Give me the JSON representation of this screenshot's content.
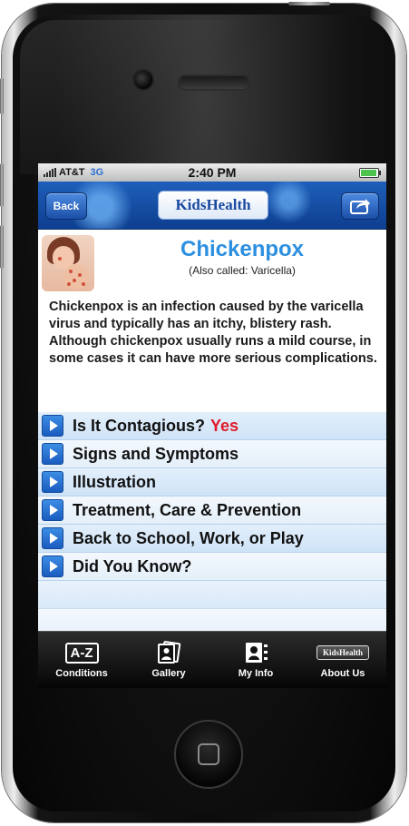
{
  "status": {
    "carrier": "AT&T",
    "network": "3G",
    "time": "2:40 PM",
    "battery_fraction": 0.95
  },
  "nav": {
    "back_label": "Back",
    "logo_text": "KidsHealth"
  },
  "article": {
    "title": "Chickenpox",
    "subtitle": "(Also called: Varicella)",
    "description": "Chickenpox is an infection caused by the varicella virus and typically has an itchy, blistery rash. Although chickenpox usually runs a mild course, in some cases it can have more serious complications."
  },
  "sections": [
    {
      "label": "Is It Contagious?",
      "answer": "Yes"
    },
    {
      "label": "Signs and Symptoms"
    },
    {
      "label": "Illustration"
    },
    {
      "label": "Treatment, Care & Prevention"
    },
    {
      "label": "Back to School, Work, or Play"
    },
    {
      "label": "Did You Know?"
    }
  ],
  "tabs": [
    {
      "label": "Conditions",
      "icon": "a-z-icon",
      "icon_text": "A-Z"
    },
    {
      "label": "Gallery",
      "icon": "gallery-icon"
    },
    {
      "label": "My Info",
      "icon": "contact-card-icon"
    },
    {
      "label": "About Us",
      "icon": "kidshealth-logo-icon",
      "icon_text": "KidsHealth"
    }
  ],
  "colors": {
    "accent": "#2d8fe0",
    "nav_blue": "#1b4fa8",
    "yes_red": "#e11a2a"
  }
}
